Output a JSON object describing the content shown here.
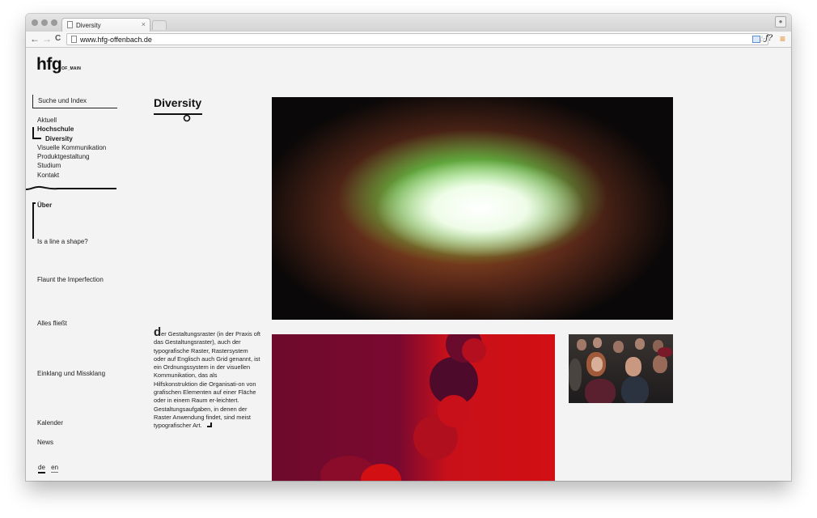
{
  "browser": {
    "tab_title": "Diversity",
    "tab_close": "×",
    "url": "www.hfg-offenbach.de",
    "back": "←",
    "forward": "→",
    "reload": "C",
    "star": "☆",
    "ext_font": "ƒ?",
    "menu": "≡"
  },
  "sidebar": {
    "logo": "hfg",
    "logo_sub": "OF_MAIN",
    "search": "Suche und Index",
    "nav": [
      {
        "label": "Aktuell"
      },
      {
        "label": "Hochschule"
      },
      {
        "label": "Diversity"
      },
      {
        "label": "Visuelle Kommunikation"
      },
      {
        "label": "Produktgestaltung"
      },
      {
        "label": "Studium"
      },
      {
        "label": "Kontakt"
      }
    ],
    "items": [
      {
        "label": "Über"
      },
      {
        "label": "Is a line a shape?"
      },
      {
        "label": "Flaunt the Imperfection"
      },
      {
        "label": "Alles fließt"
      },
      {
        "label": "Einklang und Missklang"
      },
      {
        "label": "Kalender"
      },
      {
        "label": "News"
      }
    ],
    "lang": {
      "de": "de",
      "en": "en"
    }
  },
  "main": {
    "title": "Diversity",
    "dropcap": "d",
    "body": "er Gestaltungsraster (in der Praxis oft das Gestaltungsraster), auch der typografische Raster, Rastersystem oder auf Englisch auch Grid genannt, ist ein Ordnungssystem in der visuellen Kommunikation, das als Hilfskonstruktion die Organisati-on von grafischen Elementen auf einer Fläche oder in einem Raum er-leichtert. Gestaltungsaufgaben, in denen der Raster Anwendung findet, sind meist typografischer Art."
  }
}
